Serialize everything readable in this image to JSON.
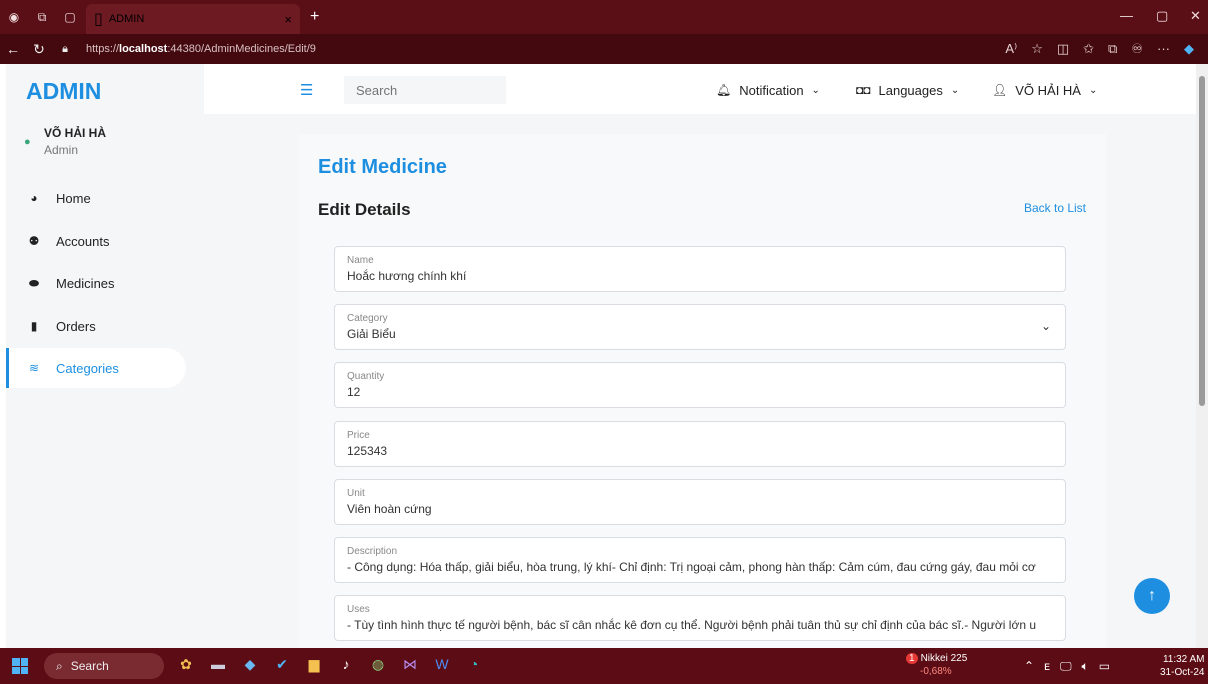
{
  "browser": {
    "tab_title": "ADMIN",
    "tab_close": "×",
    "new_tab": "+",
    "url_prefix": "https://",
    "url_host": "localhost",
    "url_path": ":44380/AdminMedicines/Edit/9"
  },
  "sidebar": {
    "brand": "ADMIN",
    "user_name": "VÕ HẢI HÀ",
    "user_role": "Admin",
    "items": [
      {
        "label": "Home",
        "icon": "dashboard-icon"
      },
      {
        "label": "Accounts",
        "icon": "users-icon"
      },
      {
        "label": "Medicines",
        "icon": "pills-icon"
      },
      {
        "label": "Orders",
        "icon": "receipt-icon"
      },
      {
        "label": "Categories",
        "icon": "layers-icon"
      }
    ],
    "active_item": "Categories"
  },
  "topbar": {
    "search_placeholder": "Search",
    "notification_label": "Notification",
    "languages_label": "Languages",
    "user_label": "VÕ HẢI HÀ"
  },
  "page": {
    "title": "Edit Medicine",
    "subtitle": "Edit Details",
    "back_link": "Back to List"
  },
  "form": {
    "name": {
      "label": "Name",
      "value": "Hoắc hương chính khí"
    },
    "category": {
      "label": "Category",
      "value": "Giải Biểu"
    },
    "quantity": {
      "label": "Quantity",
      "value": "12"
    },
    "price": {
      "label": "Price",
      "value": "125343"
    },
    "unit": {
      "label": "Unit",
      "value": "Viên hoàn cứng"
    },
    "description": {
      "label": "Description",
      "value": "- Công dụng: Hóa thấp, giải biểu, hòa trung, lý khí- Chỉ định: Trị ngoại cảm, phong hàn thấp: Cảm cúm, đau cứng gáy, đau mỏi cơ"
    },
    "uses": {
      "label": "Uses",
      "value": "- Tùy tình hình thực tế người bệnh, bác sĩ cân nhắc kê đơn cụ thể. Người bệnh phải tuân thủ sự chỉ định của bác sĩ.- Người lớn u"
    }
  },
  "taskbar": {
    "search_label": "Search",
    "nikkei_name": "Nikkei 225",
    "nikkei_change": "-0,68%",
    "nikkei_badge": "1",
    "time": "11:32 AM",
    "date": "31-Oct-24"
  },
  "colors": {
    "accent": "#1e8fe0",
    "browser_frame": "#5a0e16",
    "panel_bg": "#f5f6f8"
  }
}
